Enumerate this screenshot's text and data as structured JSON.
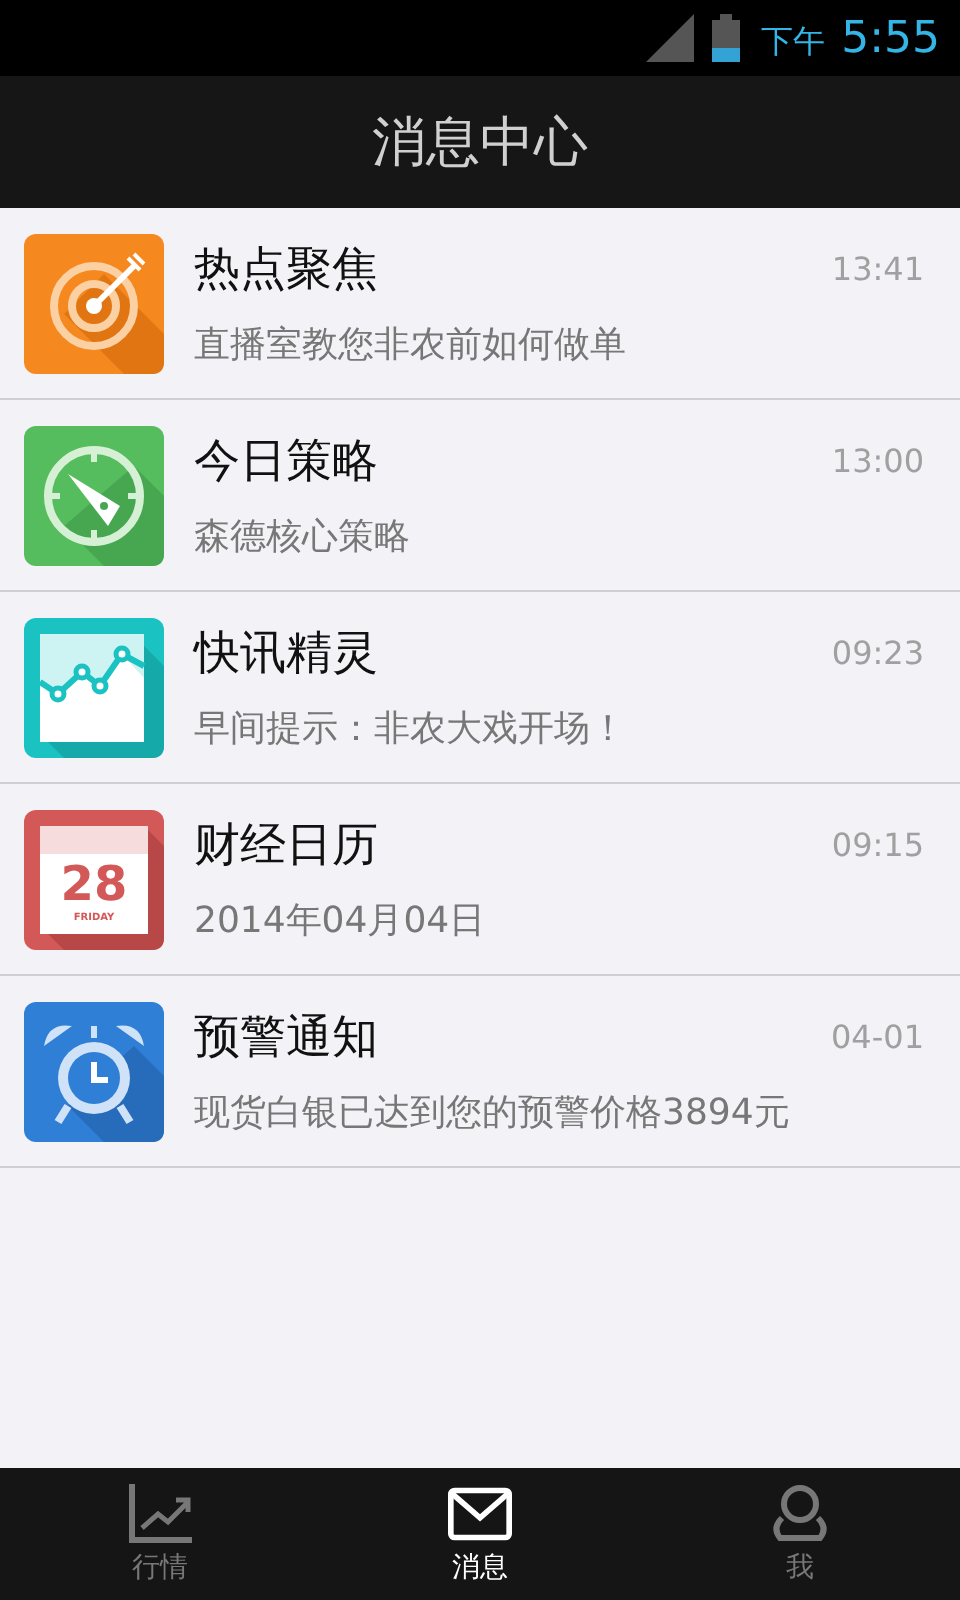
{
  "status_bar": {
    "ampm": "下午",
    "time": "5:55"
  },
  "header": {
    "title": "消息中心"
  },
  "messages": [
    {
      "kind": "target",
      "title": "热点聚焦",
      "time": "13:41",
      "preview": "直播室教您非农前如何做单"
    },
    {
      "kind": "compass",
      "title": "今日策略",
      "time": "13:00",
      "preview": "森德核心策略"
    },
    {
      "kind": "chart",
      "title": "快讯精灵",
      "time": "09:23",
      "preview": "早间提示：非农大戏开场！"
    },
    {
      "kind": "calendar",
      "title": "财经日历",
      "time": "09:15",
      "preview": "2014年04月04日",
      "icon_day": "28",
      "icon_weekday": "FRIDAY"
    },
    {
      "kind": "alarm",
      "title": "预警通知",
      "time": "04-01",
      "preview": "现货白银已达到您的预警价格3894元"
    }
  ],
  "tabs": [
    {
      "kind": "chart",
      "label": "行情",
      "selected": false
    },
    {
      "kind": "mail",
      "label": "消息",
      "selected": true
    },
    {
      "kind": "person",
      "label": "我",
      "selected": false
    }
  ]
}
